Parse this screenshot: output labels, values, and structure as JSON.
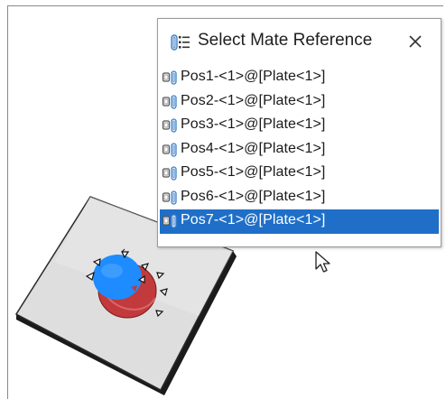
{
  "popup": {
    "title": "Select Mate Reference",
    "title_icon": "mate-reference-list-icon",
    "close_icon": "close-icon"
  },
  "items": [
    {
      "label": "Pos1-<1>@[Plate<1>]",
      "selected": false
    },
    {
      "label": "Pos2-<1>@[Plate<1>]",
      "selected": false
    },
    {
      "label": "Pos3-<1>@[Plate<1>]",
      "selected": false
    },
    {
      "label": "Pos4-<1>@[Plate<1>]",
      "selected": false
    },
    {
      "label": "Pos5-<1>@[Plate<1>]",
      "selected": false
    },
    {
      "label": "Pos6-<1>@[Plate<1>]",
      "selected": false
    },
    {
      "label": "Pos7-<1>@[Plate<1>]",
      "selected": true
    }
  ],
  "colors": {
    "selection": "#1f6fc8",
    "plate_top": "#dcdcdc",
    "plate_edge": "#2b2b2b",
    "hole": "#c8383a",
    "highlight_sphere": "#1e8cff"
  }
}
